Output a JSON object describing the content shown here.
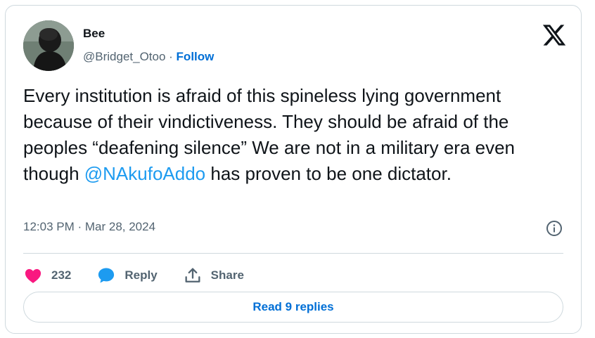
{
  "author": {
    "name": "Bee",
    "handle": "@Bridget_Otoo",
    "separator": " · ",
    "follow_label": "Follow"
  },
  "tweet": {
    "text_before": "Every institution is afraid of this spineless lying government because of their vindictiveness. They should be afraid of the peoples “deafening silence” We are not in a military era even though ",
    "mention": "@NAkufoAddo",
    "text_after": " has proven to be one dictator.",
    "timestamp": "12:03 PM · Mar 28, 2024"
  },
  "actions": {
    "like_count": "232",
    "reply_label": "Reply",
    "share_label": "Share"
  },
  "read_replies_label": "Read 9 replies",
  "icons": {
    "brand": "x-logo-icon",
    "info": "info-icon",
    "like": "heart-icon",
    "reply": "speech-bubble-icon",
    "share": "upload-share-icon"
  },
  "colors": {
    "link": "#1d9bf0",
    "follow": "#006fd6",
    "heart": "#f91880",
    "reply_icon": "#1d9bf0",
    "muted": "#536471",
    "border": "#cfd9de"
  }
}
